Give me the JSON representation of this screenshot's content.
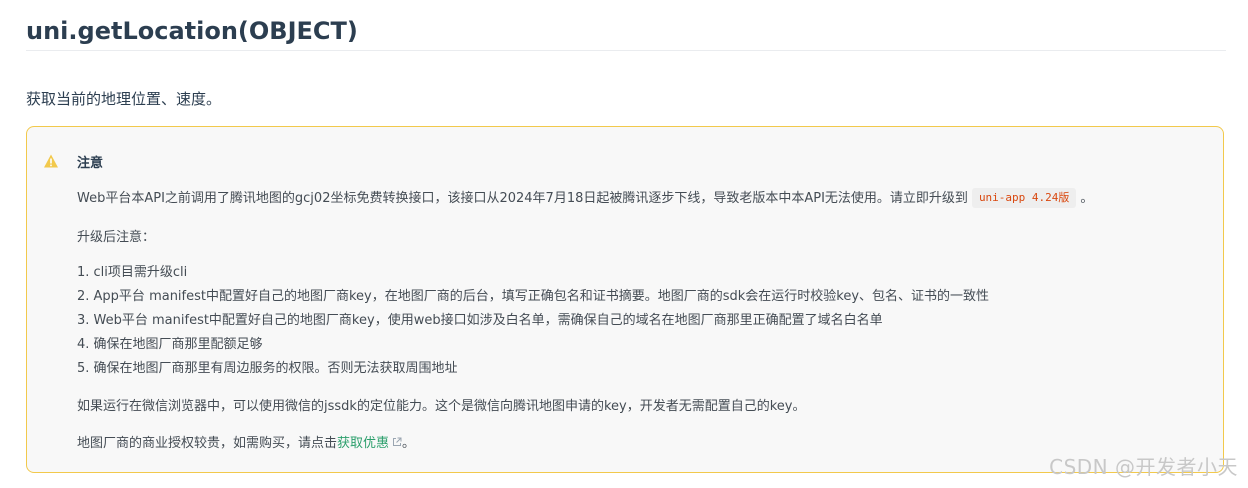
{
  "header": {
    "title": "uni.getLocation(OBJECT)"
  },
  "description": "获取当前的地理位置、速度。",
  "tip": {
    "title": "注意",
    "para1_before": "Web平台本API之前调用了腾讯地图的gcj02坐标免费转换接口，该接口从2024年7月18日起被腾讯逐步下线，导致老版本中本API无法使用。请立即升级到",
    "para1_code": "uni-app 4.24版",
    "para1_after": "。",
    "para2": "升级后注意：",
    "list": [
      "1. cli项目需升级cli",
      "2. App平台 manifest中配置好自己的地图厂商key，在地图厂商的后台，填写正确包名和证书摘要。地图厂商的sdk会在运行时校验key、包名、证书的一致性",
      "3. Web平台 manifest中配置好自己的地图厂商key，使用web接口如涉及白名单，需确保自己的域名在地图厂商那里正确配置了域名白名单",
      "4. 确保在地图厂商那里配额足够",
      "5. 确保在地图厂商那里有周边服务的权限。否则无法获取周围地址"
    ],
    "para3": "如果运行在微信浏览器中，可以使用微信的jssdk的定位能力。这个是微信向腾讯地图申请的key，开发者无需配置自己的key。",
    "para4_before": "地图厂商的商业授权较贵，如需购买，请点击",
    "para4_link": "获取优惠",
    "para4_after": "。",
    "border_color": "#f2c94c",
    "icon": "warning-icon"
  },
  "watermark": "CSDN @开发者小天"
}
